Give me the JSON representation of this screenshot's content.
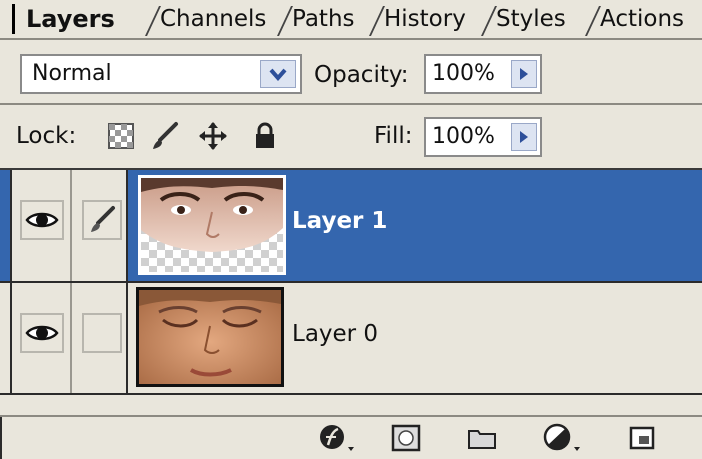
{
  "tabs": [
    {
      "label": "Layers",
      "active": true
    },
    {
      "label": "Channels",
      "active": false
    },
    {
      "label": "Paths",
      "active": false
    },
    {
      "label": "History",
      "active": false
    },
    {
      "label": "Styles",
      "active": false
    },
    {
      "label": "Actions",
      "active": false
    }
  ],
  "blend_mode": {
    "value": "Normal"
  },
  "opacity": {
    "label": "Opacity:",
    "value": "100%"
  },
  "lock": {
    "label": "Lock:",
    "icons": [
      "lock-transparency-icon",
      "lock-pixels-icon",
      "lock-position-icon",
      "lock-all-icon"
    ]
  },
  "fill": {
    "label": "Fill:",
    "value": "100%"
  },
  "layers": [
    {
      "name": "Layer 1",
      "selected": true,
      "visible": true,
      "linked_brush": true
    },
    {
      "name": "Layer 0",
      "selected": false,
      "visible": true,
      "linked_brush": false
    }
  ],
  "footer_icons": [
    "layer-style-icon",
    "layer-mask-icon",
    "new-group-icon",
    "adjustment-layer-icon",
    "new-layer-icon"
  ],
  "colors": {
    "selected": "#3466ae",
    "panel": "#e9e6dc"
  }
}
